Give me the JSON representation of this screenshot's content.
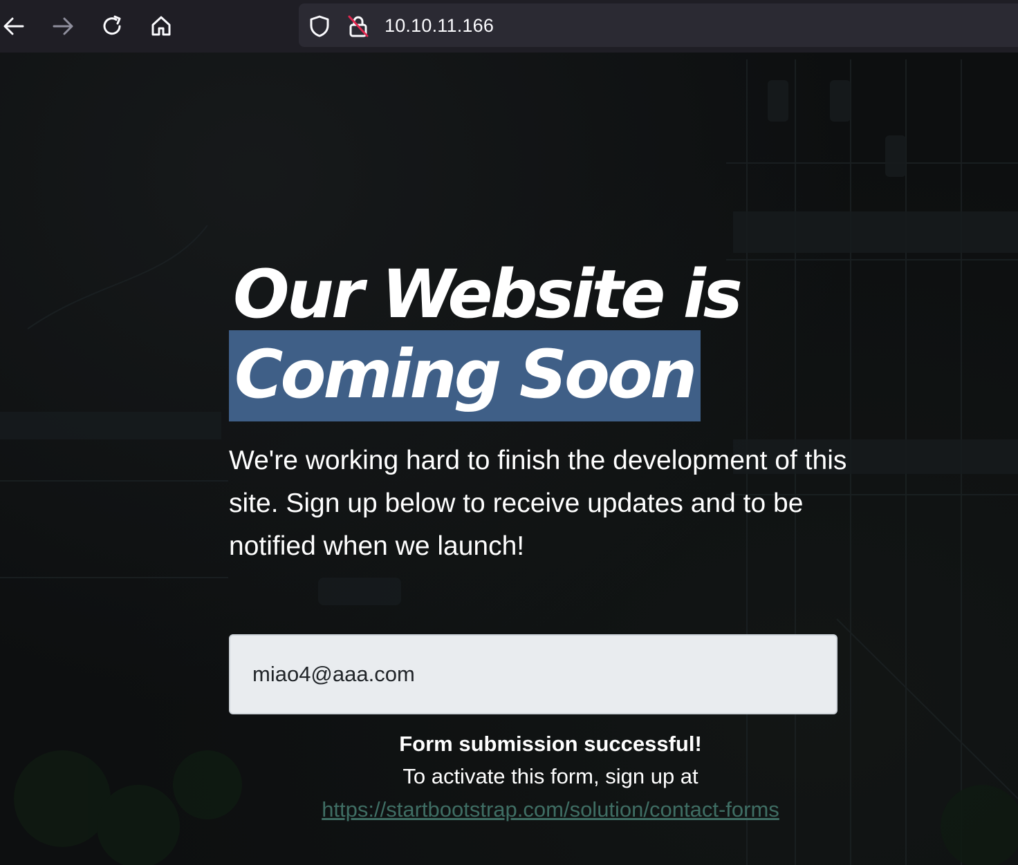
{
  "browser": {
    "back_icon": "arrow-left-icon",
    "forward_icon": "arrow-right-icon",
    "reload_icon": "reload-icon",
    "home_icon": "home-icon",
    "shield_icon": "shield-icon",
    "insecure_icon": "insecure-lock-icon",
    "url": "10.10.11.166"
  },
  "page": {
    "headline_line1": "Our Website is",
    "headline_line2": "Coming Soon",
    "highlight_color": "#3f5f87",
    "lead": "We're working hard to finish the development of this site. Sign up below to receive updates and to be notified when we launch!",
    "email_value": "miao4@aaa.com",
    "success_message": "Form submission successful!",
    "activate_note": "To activate this form, sign up at",
    "activate_link": "https://startbootstrap.com/solution/contact-forms"
  }
}
